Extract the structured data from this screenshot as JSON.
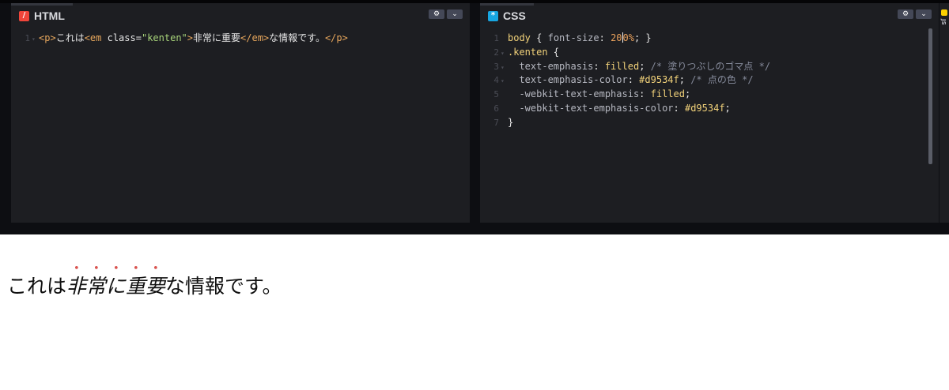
{
  "colors": {
    "editor_bg": "#1d1e22",
    "emphasis": "#d9534f",
    "html_icon": "#f0453a",
    "css_icon": "#17a6e1",
    "js_icon": "#fcd000"
  },
  "html_panel": {
    "tab_label": "HTML",
    "icon": "slash-icon",
    "gear_icon": "gear-icon",
    "chevron_icon": "chevron-down-icon",
    "lines": [
      {
        "n": "1",
        "tokens": [
          {
            "t": "<p>",
            "c": "t-tag"
          },
          {
            "t": "これは",
            "c": "t-plain"
          },
          {
            "t": "<em ",
            "c": "t-tag"
          },
          {
            "t": "class=",
            "c": "t-attr"
          },
          {
            "t": "\"kenten\"",
            "c": "t-str"
          },
          {
            "t": ">",
            "c": "t-tag"
          },
          {
            "t": "非常に重要",
            "c": "t-plain"
          },
          {
            "t": "</em>",
            "c": "t-tag"
          },
          {
            "t": "な情報です。",
            "c": "t-plain"
          },
          {
            "t": "</p>",
            "c": "t-tag"
          }
        ]
      }
    ]
  },
  "css_panel": {
    "tab_label": "CSS",
    "icon": "asterisk-icon",
    "gear_icon": "gear-icon",
    "chevron_icon": "chevron-down-icon",
    "lines": [
      {
        "n": "1",
        "fold": false,
        "tokens": [
          {
            "t": "body",
            "c": "t-sel"
          },
          {
            "t": " { ",
            "c": "t-punc"
          },
          {
            "t": "font-size",
            "c": "t-prop"
          },
          {
            "t": ": ",
            "c": "t-punc"
          },
          {
            "t": "20",
            "c": "t-num"
          },
          {
            "t": "|cursor|",
            "c": "cursor"
          },
          {
            "t": "0%",
            "c": "t-num"
          },
          {
            "t": "; }",
            "c": "t-punc"
          }
        ]
      },
      {
        "n": "2",
        "fold": true,
        "tokens": [
          {
            "t": ".kenten",
            "c": "t-sel"
          },
          {
            "t": " {",
            "c": "t-punc"
          }
        ]
      },
      {
        "n": "3",
        "fold": true,
        "tokens": [
          {
            "t": "  text-emphasis",
            "c": "t-prop"
          },
          {
            "t": ": ",
            "c": "t-punc"
          },
          {
            "t": "filled",
            "c": "t-val"
          },
          {
            "t": "; ",
            "c": "t-punc"
          },
          {
            "t": "/* 塗りつぶしのゴマ点 */",
            "c": "t-com"
          }
        ]
      },
      {
        "n": "4",
        "fold": true,
        "tokens": [
          {
            "t": "  text-emphasis-color",
            "c": "t-prop"
          },
          {
            "t": ": ",
            "c": "t-punc"
          },
          {
            "t": "#d9534f",
            "c": "t-val"
          },
          {
            "t": "; ",
            "c": "t-punc"
          },
          {
            "t": "/* 点の色 */",
            "c": "t-com"
          }
        ]
      },
      {
        "n": "5",
        "fold": false,
        "tokens": [
          {
            "t": "  -webkit-text-emphasis",
            "c": "t-prop"
          },
          {
            "t": ": ",
            "c": "t-punc"
          },
          {
            "t": "filled",
            "c": "t-val"
          },
          {
            "t": ";",
            "c": "t-punc"
          }
        ]
      },
      {
        "n": "6",
        "fold": false,
        "tokens": [
          {
            "t": "  -webkit-text-emphasis-color",
            "c": "t-prop"
          },
          {
            "t": ": ",
            "c": "t-punc"
          },
          {
            "t": "#d9534f",
            "c": "t-val"
          },
          {
            "t": ";",
            "c": "t-punc"
          }
        ]
      },
      {
        "n": "7",
        "fold": false,
        "tokens": [
          {
            "t": "}",
            "c": "t-punc"
          }
        ]
      }
    ]
  },
  "js_panel": {
    "tab_label": "JS",
    "icon": "js-icon"
  },
  "result": {
    "before": "これは",
    "emphasized": "非常に重要",
    "after": "な情報です。"
  }
}
